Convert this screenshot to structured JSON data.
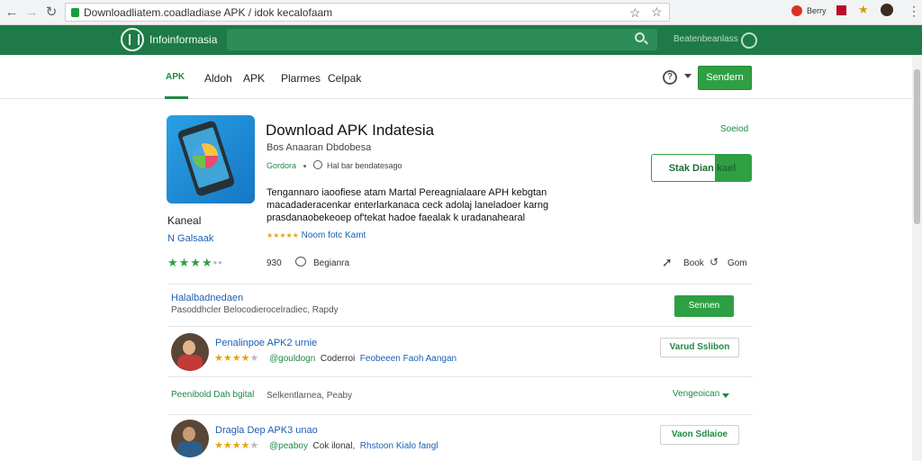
{
  "browser": {
    "url": "Downloadliatem.coadladiase APK / idok kecalofaam",
    "ext_label": "Berry"
  },
  "header": {
    "site_name": "Infoinformasia",
    "right_link": "Beatenbeanlass"
  },
  "nav": {
    "tabs": [
      "APK",
      "Aldoh",
      "APK",
      "Plarmes",
      "Celpak"
    ]
  },
  "app": {
    "title": "Download APK Indatesia",
    "subtitle": "Bos Anaaran Dbdobesa",
    "developer": "Gordora",
    "info": "Hal bar bendatesago",
    "description": [
      "Tengannaro iaoofiese atam Martal Pereagnialaare APH kebgtan",
      "macadaderacenkar enterlarkanaca ceck adolaj laneladoer karng",
      "prasdanaobekeoep of'tekat hadoe faealak k uradanahearal"
    ],
    "rating_text": "Noom fotc Kamt",
    "side_name": "Kaneal",
    "side_dev": "Galsaak",
    "side_dev_prefix": "N",
    "rating": 4,
    "link": "Soeiod",
    "install_label": "Stak Dian kael",
    "count": "930",
    "stat_label": "Begianra",
    "share_label": "Book",
    "more_label": "Gom",
    "sign_in": "Sendern"
  },
  "section": {
    "title": "Halalbadnedaen",
    "subtitle": "Pasoddhcler Belocodierocelradiec, Rapdy",
    "button": "Sennen"
  },
  "items": [
    {
      "title": "Penalinpoe APK2 urnie",
      "handle": "@gouldogn",
      "meta_a": "Coderroi",
      "meta_b": "Feobeeen Faoh Aangan",
      "button": "Varud Sslibon",
      "rating": 4
    },
    {
      "title": "Dragla Dep APK3 unao",
      "handle": "@peaboy",
      "meta_a": "Cok ilonal,",
      "meta_b": "Rhstoon Kialo fangl",
      "button": "Vaon Sdlaioe",
      "rating": 4
    }
  ],
  "section2": {
    "title": "Peenibold Dah bgital",
    "subtitle": "Selkentlarnea, Peaby",
    "dropdown": "Vengeoican"
  },
  "colors": {
    "header_green": "#1e7a46",
    "accent_green": "#2ea043",
    "link_blue": "#1a5fb4",
    "star_gold": "#e8a314"
  }
}
